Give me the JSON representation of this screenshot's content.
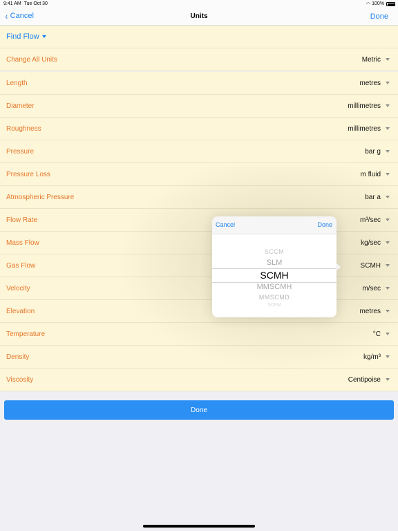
{
  "status_bar": {
    "time": "9:41 AM",
    "date": "Tue Oct 30",
    "battery": "100%"
  },
  "nav": {
    "cancel": "Cancel",
    "title": "Units",
    "done": "Done"
  },
  "find_flow": "Find Flow",
  "change_all": {
    "label": "Change All Units",
    "value": "Metric"
  },
  "units": [
    {
      "label": "Length",
      "value": "metres"
    },
    {
      "label": "Diameter",
      "value": "millimetres"
    },
    {
      "label": "Roughness",
      "value": "millimetres"
    },
    {
      "label": "Pressure",
      "value": "bar g"
    },
    {
      "label": "Pressure Loss",
      "value": "m fluid"
    },
    {
      "label": "Atmospheric Pressure",
      "value": "bar a"
    },
    {
      "label": "Flow Rate",
      "value": "m³/sec"
    },
    {
      "label": "Mass Flow",
      "value": "kg/sec"
    },
    {
      "label": "Gas Flow",
      "value": "SCMH"
    },
    {
      "label": "Velocity",
      "value": "m/sec"
    },
    {
      "label": "Elevation",
      "value": "metres"
    },
    {
      "label": "Temperature",
      "value": "°C"
    },
    {
      "label": "Density",
      "value": "kg/m³"
    },
    {
      "label": "Viscosity",
      "value": "Centipoise"
    }
  ],
  "bottom_done": "Done",
  "picker": {
    "cancel": "Cancel",
    "done": "Done",
    "options": [
      "SCCM",
      "SLM",
      "SCMH",
      "MMSCMH",
      "MMSCMD",
      "SCFM"
    ],
    "selected": "SCMH"
  },
  "colors": {
    "accent": "#1d83f1",
    "label": "#e6762a",
    "row_bg": "#fdf6d8",
    "button": "#2b8ff3"
  }
}
